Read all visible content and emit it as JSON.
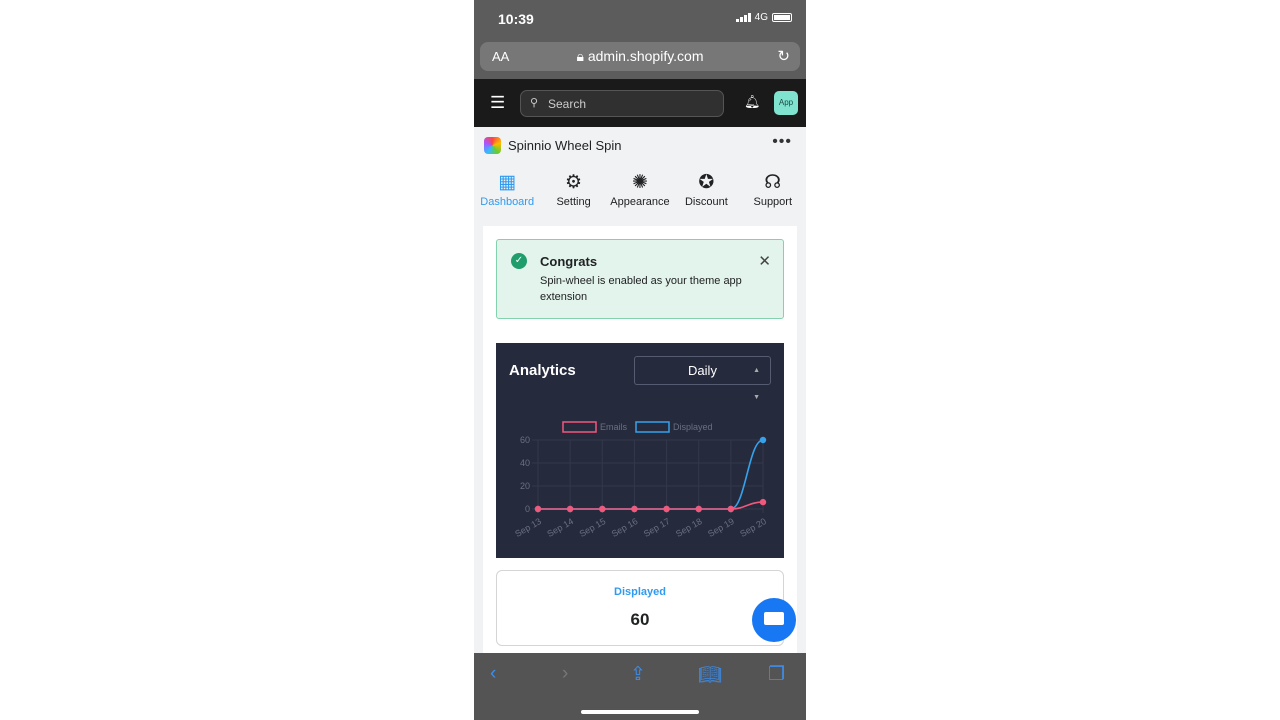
{
  "status_bar": {
    "time": "10:39",
    "network": "4G"
  },
  "browser": {
    "text_size": "AA",
    "url": "admin.shopify.com"
  },
  "shopify": {
    "search_placeholder": "Search",
    "app_badge": "App"
  },
  "app": {
    "name": "Spinnio Wheel Spin",
    "more": "•••"
  },
  "nav": [
    {
      "label": "Dashboard",
      "icon": "dashboard-icon",
      "active": true
    },
    {
      "label": "Setting",
      "icon": "gear-icon"
    },
    {
      "label": "Appearance",
      "icon": "wheel-icon"
    },
    {
      "label": "Discount",
      "icon": "discount-icon"
    },
    {
      "label": "Support",
      "icon": "headset-icon"
    }
  ],
  "banner": {
    "title": "Congrats",
    "text": "Spin-wheel is enabled as your theme app extension"
  },
  "analytics": {
    "title": "Analytics",
    "period": "Daily"
  },
  "chart_data": {
    "type": "line",
    "categories": [
      "Sep 13",
      "Sep 14",
      "Sep 15",
      "Sep 16",
      "Sep 17",
      "Sep 18",
      "Sep 19",
      "Sep 20"
    ],
    "series": [
      {
        "name": "Emails",
        "values": [
          0,
          0,
          0,
          0,
          0,
          0,
          0,
          6
        ],
        "color": "#f0587c"
      },
      {
        "name": "Displayed",
        "values": [
          0,
          0,
          0,
          0,
          0,
          0,
          0,
          60
        ],
        "color": "#36a2eb"
      }
    ],
    "yticks": [
      0,
      20,
      40,
      60
    ],
    "ylim": [
      0,
      60
    ],
    "grid": true,
    "legend": "top"
  },
  "stat": {
    "label": "Displayed",
    "value": "60"
  }
}
